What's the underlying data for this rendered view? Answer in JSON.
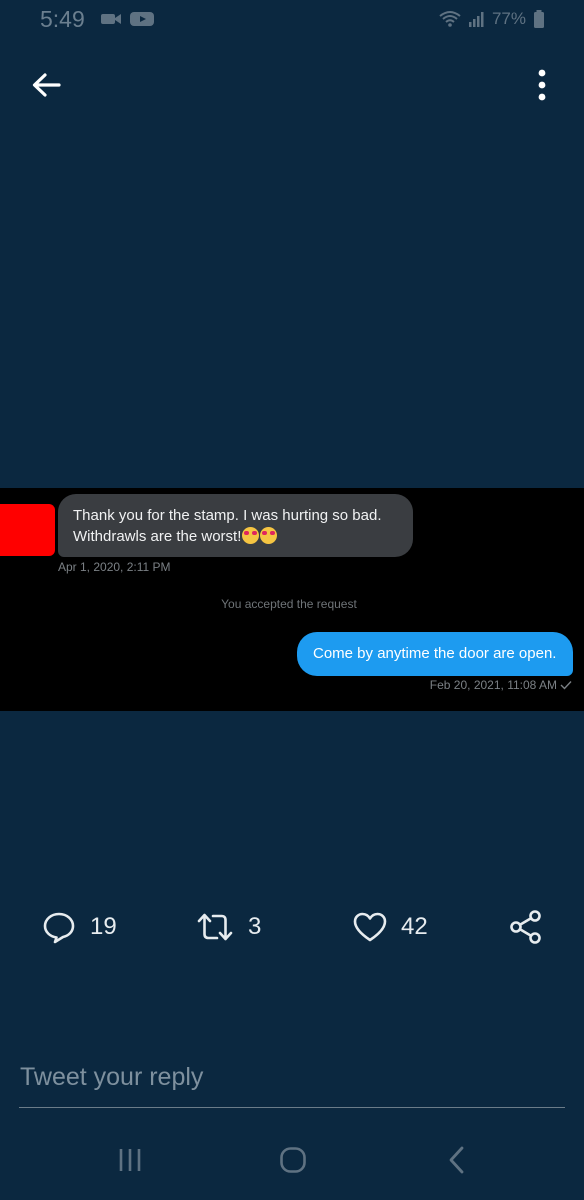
{
  "status_bar": {
    "time": "5:49",
    "battery": "77%",
    "icons": [
      "video-call-icon",
      "youtube-icon",
      "wifi-icon",
      "signal-icon",
      "battery-icon"
    ]
  },
  "header": {
    "back_icon": "arrow-left-icon",
    "menu_icon": "more-vertical-icon"
  },
  "media": {
    "incoming_message": {
      "text": "Thank you for the stamp. I was hurting so bad. Withdrawls are the worst!",
      "emojis": [
        "heart-eyes-emoji",
        "heart-eyes-emoji"
      ],
      "timestamp": "Apr 1, 2020, 2:11 PM"
    },
    "system_message": "You accepted the request",
    "outgoing_message": {
      "text": "Come by anytime the door are open.",
      "timestamp": "Feb 20, 2021, 11:08 AM",
      "status_icon": "checkmark-icon"
    },
    "avatar_color": "#ff0000"
  },
  "actions": {
    "replies": "19",
    "retweets": "3",
    "likes": "42"
  },
  "reply": {
    "placeholder": "Tweet your reply"
  },
  "navigation": {
    "icons": [
      "recent-apps-icon",
      "home-icon",
      "back-icon"
    ]
  },
  "colors": {
    "background": "#0b2840",
    "accent": "#1d9bf0",
    "incoming_bubble": "#3a3d41"
  }
}
